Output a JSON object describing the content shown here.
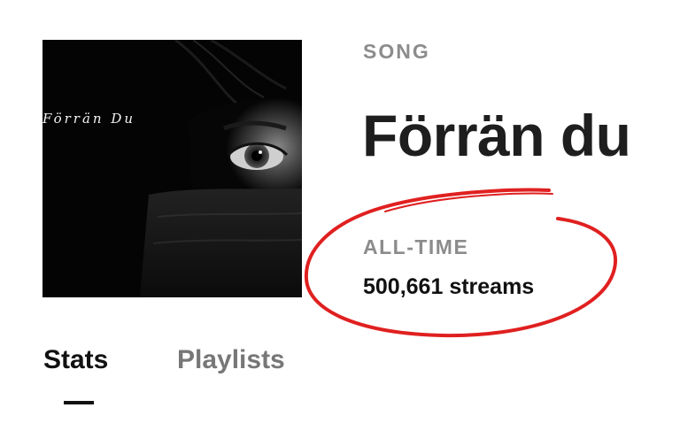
{
  "cover": {
    "title_text": "Förrän Du",
    "icon": "album-cover-art"
  },
  "song": {
    "type_label": "SONG",
    "title": "Förrän du"
  },
  "stats": {
    "alltime_label": "ALL-TIME",
    "streams_text": "500,661 streams"
  },
  "tabs": [
    {
      "label": "Stats",
      "active": true
    },
    {
      "label": "Playlists",
      "active": false
    }
  ],
  "colors": {
    "annotation": "#e02020",
    "label_gray": "#8c8c8c",
    "title": "#1e1e1e"
  }
}
